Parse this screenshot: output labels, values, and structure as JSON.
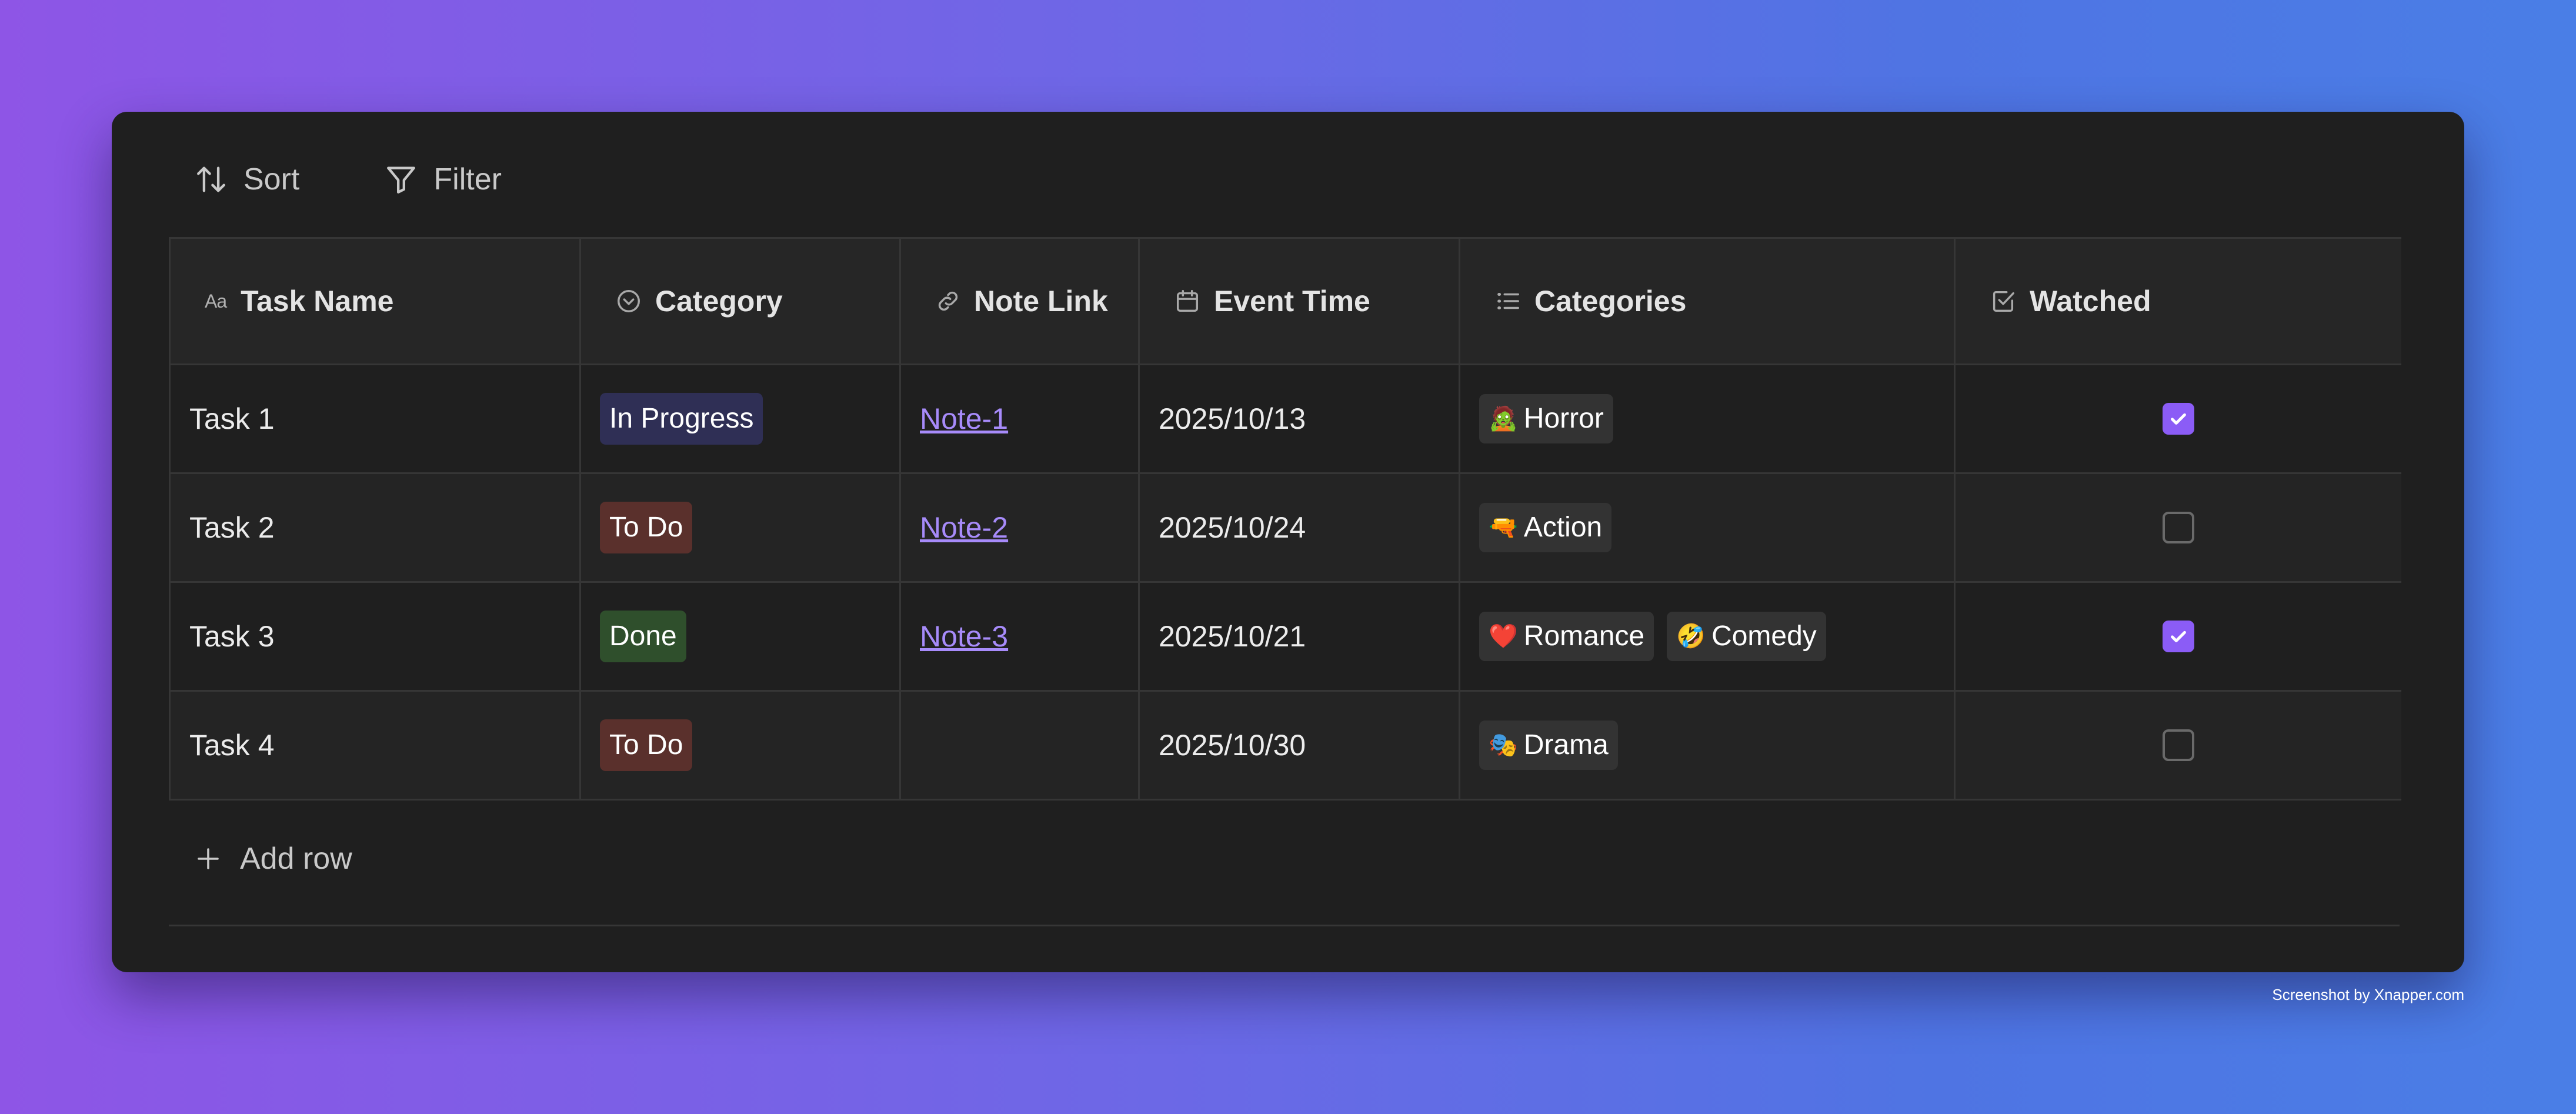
{
  "toolbar": {
    "sort_label": "Sort",
    "filter_label": "Filter"
  },
  "columns": [
    {
      "label": "Task Name",
      "icon": "text-type-icon",
      "icon_text": "Aa"
    },
    {
      "label": "Category",
      "icon": "select-chevron-icon"
    },
    {
      "label": "Note Link",
      "icon": "link-icon"
    },
    {
      "label": "Event Time",
      "icon": "calendar-icon"
    },
    {
      "label": "Categories",
      "icon": "list-icon"
    },
    {
      "label": "Watched",
      "icon": "checkbox-icon"
    }
  ],
  "rows": [
    {
      "task": "Task 1",
      "category": "In Progress",
      "note": "Note-1",
      "event_time": "2025/10/13",
      "tags": [
        {
          "emoji": "🧟",
          "label": "Horror"
        }
      ],
      "watched": true
    },
    {
      "task": "Task 2",
      "category": "To Do",
      "note": "Note-2",
      "event_time": "2025/10/24",
      "tags": [
        {
          "emoji": "🔫",
          "label": "Action"
        }
      ],
      "watched": false
    },
    {
      "task": "Task 3",
      "category": "Done",
      "note": "Note-3",
      "event_time": "2025/10/21",
      "tags": [
        {
          "emoji": "❤️",
          "label": "Romance"
        },
        {
          "emoji": "🤣",
          "label": "Comedy"
        }
      ],
      "watched": true
    },
    {
      "task": "Task 4",
      "category": "To Do",
      "note": "",
      "event_time": "2025/10/30",
      "tags": [
        {
          "emoji": "🎭",
          "label": "Drama"
        }
      ],
      "watched": false
    }
  ],
  "status_colors": {
    "In Progress": "#2f2f55",
    "To Do": "#5a302c",
    "Done": "#2f4f2c"
  },
  "add_row_label": "Add row",
  "credit": "Screenshot by Xnapper.com",
  "colors": {
    "accent": "#8b5cf6",
    "link": "#a78bfa",
    "window_bg": "#1f1f1f"
  }
}
